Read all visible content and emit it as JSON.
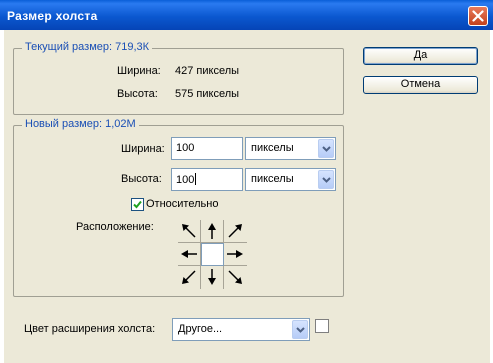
{
  "window": {
    "title": "Размер холста"
  },
  "buttons": {
    "ok": "Да",
    "cancel": "Отмена"
  },
  "current_size": {
    "title": "Текущий размер: 719,3К",
    "width_label": "Ширина:",
    "width_value": "427 пикселы",
    "height_label": "Высота:",
    "height_value": "575 пикселы"
  },
  "new_size": {
    "title": "Новый размер: 1,02М",
    "width_label": "Ширина:",
    "width_value": "100",
    "width_unit": "пикселы",
    "height_label": "Высота:",
    "height_value": "100",
    "height_unit": "пикселы",
    "relative_label": "Относительно",
    "relative_checked": true,
    "anchor_label": "Расположение:"
  },
  "extension": {
    "label": "Цвет расширения холста:",
    "value": "Другое...",
    "swatch_color": "#ffffff"
  }
}
